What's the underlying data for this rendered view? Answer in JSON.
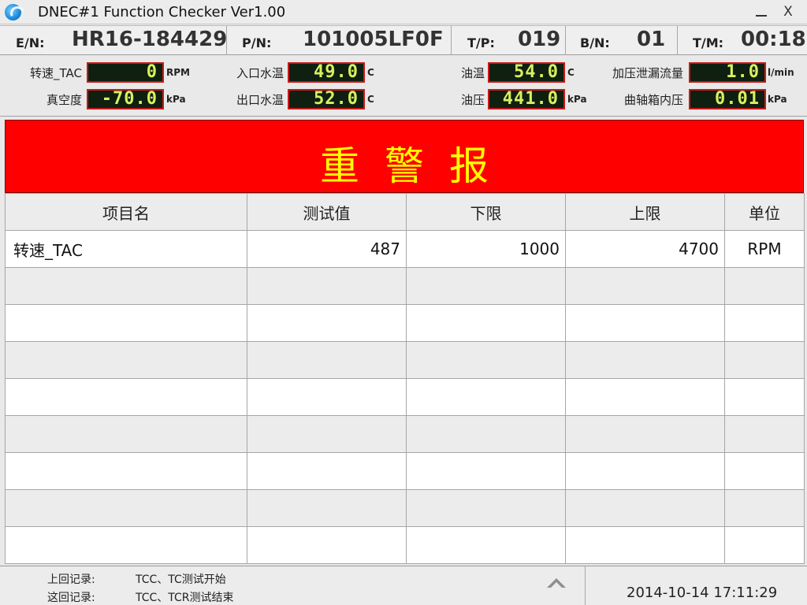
{
  "window": {
    "title": "DNEC#1 Function Checker Ver1.00",
    "minimize_label": "_",
    "close_label": "X"
  },
  "header": {
    "en_label": "E/N:",
    "en_value": "HR16-184429",
    "pn_label": "P/N:",
    "pn_value": "101005LF0F",
    "tp_label": "T/P:",
    "tp_value": "019",
    "bn_label": "B/N:",
    "bn_value": "01",
    "tm_label": "T/M:",
    "tm_value": "00:18"
  },
  "sensors": [
    {
      "label": "转速_TAC",
      "value": "0",
      "unit": "RPM"
    },
    {
      "label": "入口水温",
      "value": "49.0",
      "unit": "C"
    },
    {
      "label": "油温",
      "value": "54.0",
      "unit": "C"
    },
    {
      "label": "加压泄漏流量",
      "value": "1.0",
      "unit": "l/min"
    },
    {
      "label": "真空度",
      "value": "-70.0",
      "unit": "kPa"
    },
    {
      "label": "出口水温",
      "value": "52.0",
      "unit": "C"
    },
    {
      "label": "油压",
      "value": "441.0",
      "unit": "kPa"
    },
    {
      "label": "曲轴箱内压",
      "value": "0.01",
      "unit": "kPa"
    }
  ],
  "alarm": {
    "text": "重警报",
    "color": "#ff0000",
    "text_color": "#ffff00"
  },
  "table": {
    "headers": [
      "项目名",
      "测试值",
      "下限",
      "上限",
      "单位"
    ],
    "rows": [
      [
        "转速_TAC",
        "487",
        "1000",
        "4700",
        "RPM"
      ],
      [
        "",
        "",
        "",
        "",
        ""
      ],
      [
        "",
        "",
        "",
        "",
        ""
      ],
      [
        "",
        "",
        "",
        "",
        ""
      ],
      [
        "",
        "",
        "",
        "",
        ""
      ],
      [
        "",
        "",
        "",
        "",
        ""
      ],
      [
        "",
        "",
        "",
        "",
        ""
      ],
      [
        "",
        "",
        "",
        "",
        ""
      ],
      [
        "",
        "",
        "",
        "",
        ""
      ]
    ]
  },
  "footer": {
    "prev_label": "上回记录:",
    "prev_value": "TCC、TC测试开始",
    "curr_label": "这回记录:",
    "curr_value": "TCC、TCR测试结束",
    "datetime": "2014-10-14 17:11:29"
  }
}
